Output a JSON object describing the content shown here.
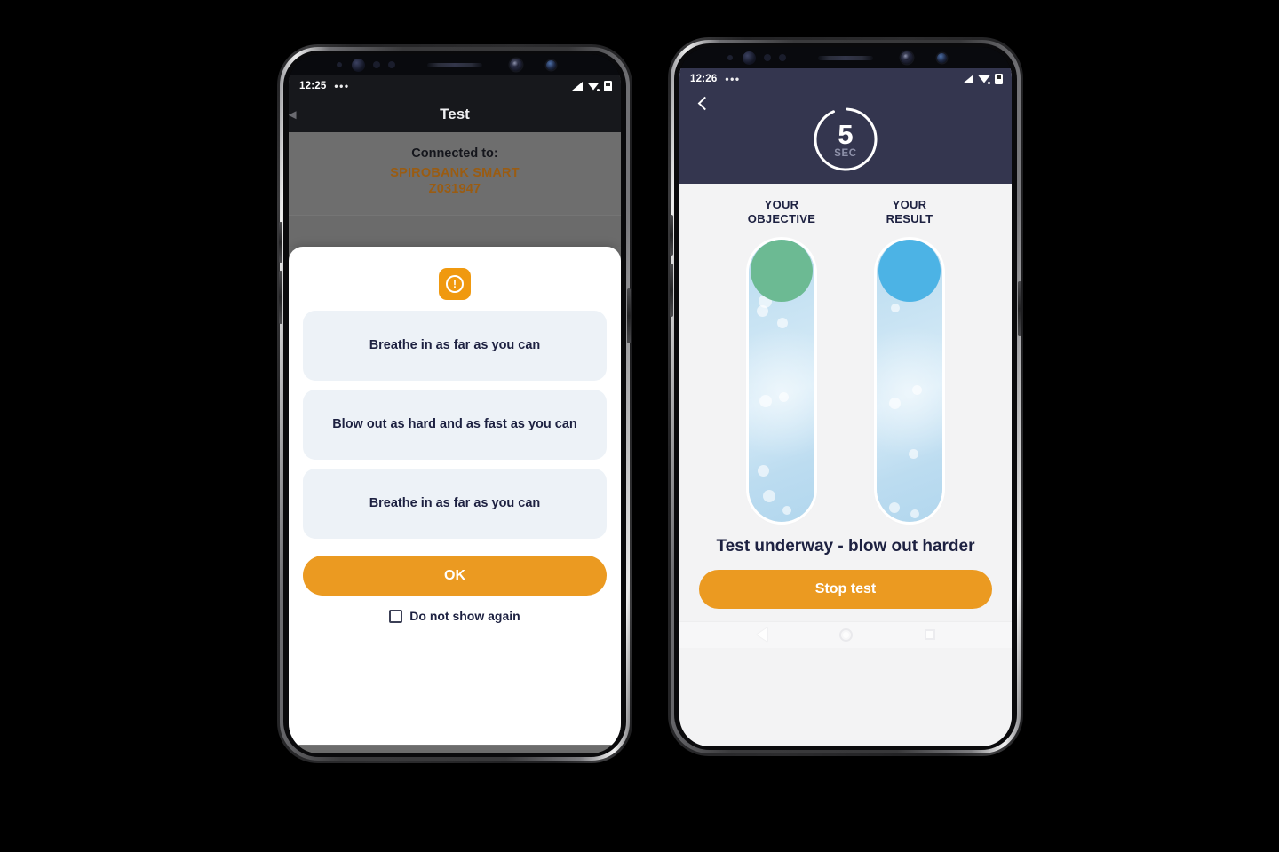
{
  "colors": {
    "accent_orange": "#eb9a21",
    "warn_orange": "#f0990f",
    "navy": "#1d2141",
    "header_navy": "#34364f",
    "device_name_brown": "#9a5c12",
    "objective_green": "#6cba93",
    "result_blue": "#4cb3e5",
    "card_bg": "#edf2f7",
    "overlay_grey": "#6e6e6e"
  },
  "left_phone": {
    "status_bar": {
      "time": "12:25",
      "overflow_dots": "•••",
      "icons": [
        "signal-icon",
        "wifi-icon",
        "battery-icon"
      ]
    },
    "app_bar": {
      "title": "Test",
      "back_icon": "back-arrow-icon"
    },
    "connection": {
      "label": "Connected to:",
      "device_name": "SPIROBANK SMART",
      "device_serial": "Z031947"
    },
    "dialog": {
      "icon": "warning-exclamation-icon",
      "icon_glyph": "!",
      "steps": [
        "Breathe in as far as you can",
        "Blow out as hard and as fast as you can",
        "Breathe in as far as you can"
      ],
      "confirm_label": "OK",
      "checkbox_label": "Do not show again",
      "checkbox_checked": false
    },
    "nav_bar": {
      "back": "nav-back-icon",
      "home": "nav-home-icon",
      "recents": "nav-recents-icon"
    }
  },
  "right_phone": {
    "status_bar": {
      "time": "12:26",
      "overflow_dots": "•••",
      "icons": [
        "signal-icon",
        "wifi-icon",
        "battery-icon"
      ]
    },
    "header": {
      "back_icon": "chevron-left-icon",
      "timer_value": "5",
      "timer_unit": "SEC",
      "timer_progress_percent": 92
    },
    "columns": [
      {
        "title_line1": "YOUR",
        "title_line2": "OBJECTIVE",
        "cap_color": "#6cba93",
        "fill_percent": 100
      },
      {
        "title_line1": "YOUR",
        "title_line2": "RESULT",
        "cap_color": "#4cb3e5",
        "fill_percent": 100
      }
    ],
    "status_message": "Test underway - blow out harder",
    "stop_label": "Stop test",
    "nav_bar": {
      "back": "nav-back-icon",
      "home": "nav-home-icon",
      "recents": "nav-recents-icon"
    }
  }
}
